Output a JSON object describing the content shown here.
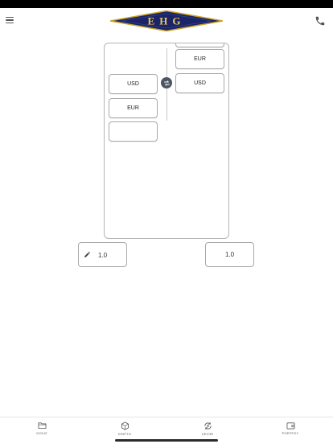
{
  "header": {
    "logo_text": "EHG",
    "menu_icon": "hamburger-menu-icon",
    "phone_icon": "phone-icon"
  },
  "converter": {
    "from_list": [
      {
        "code": "USD"
      },
      {
        "code": "EUR"
      }
    ],
    "to_list": [
      {
        "code": "EUR"
      },
      {
        "code": "USD"
      }
    ],
    "swap_icon": "swap-arrows-icon"
  },
  "amount": {
    "input_value": "1.0",
    "output_value": "1.0",
    "edit_icon": "pencil-icon"
  },
  "nav": {
    "items": [
      {
        "label": "DOVIZ",
        "icon": "folder-icon"
      },
      {
        "label": "KRIPTO",
        "icon": "crypto-cube-icon"
      },
      {
        "label": "CEVIRI",
        "icon": "currency-exchange-icon"
      },
      {
        "label": "PORTFOY",
        "icon": "wallet-icon"
      }
    ]
  },
  "colors": {
    "logo_navy": "#1b2466",
    "logo_gold": "#c9a227",
    "swap_button": "#4c5563",
    "border": "#a9a9a9"
  }
}
